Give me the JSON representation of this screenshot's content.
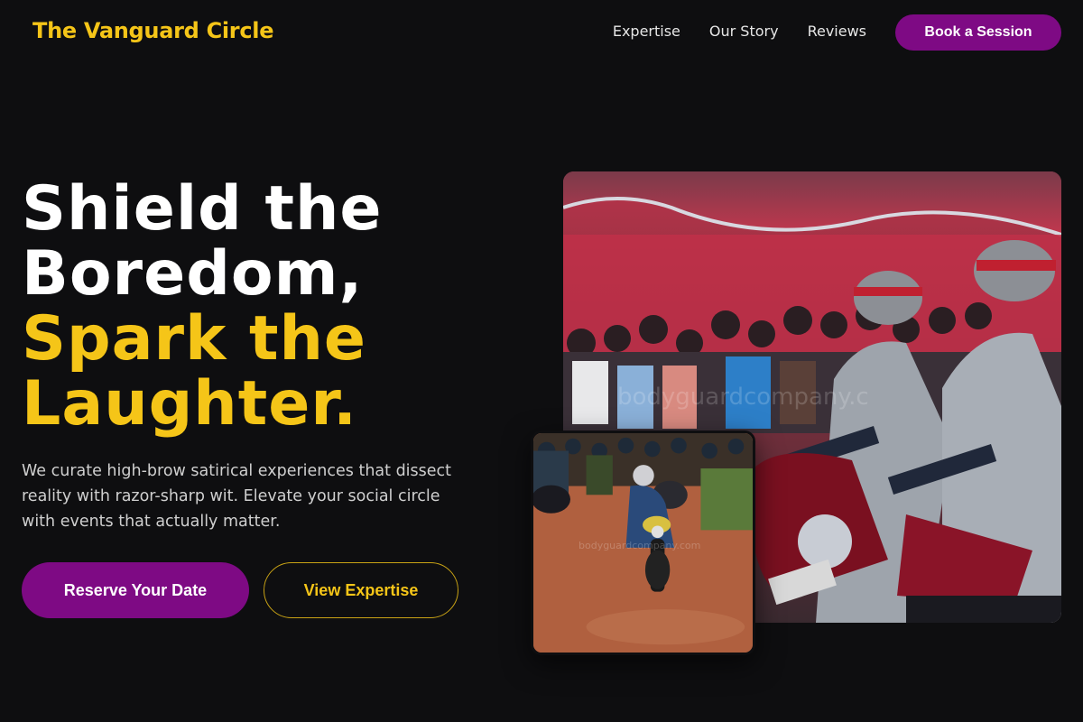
{
  "nav": {
    "brand": "The Vanguard Circle",
    "links": [
      "Expertise",
      "Our Story",
      "Reviews"
    ],
    "cta": "Book a Session"
  },
  "hero": {
    "title_white_1": "Shield the",
    "title_white_2": "Boredom,",
    "title_yellow_1": "Spark the",
    "title_yellow_2": "Laughter.",
    "description": "We curate high-brow satirical experiences that dissect reality with razor-sharp wit. Elevate your social circle with events that actually matter.",
    "primary_button": "Reserve Your Date",
    "secondary_button": "View Expertise"
  },
  "images": {
    "main_watermark": "bodyguardcompany.c",
    "small_watermark": "bodyguardcompany.com"
  },
  "colors": {
    "background": "#0e0e10",
    "accent_yellow": "#f5c518",
    "accent_purple": "#7e0a84"
  }
}
